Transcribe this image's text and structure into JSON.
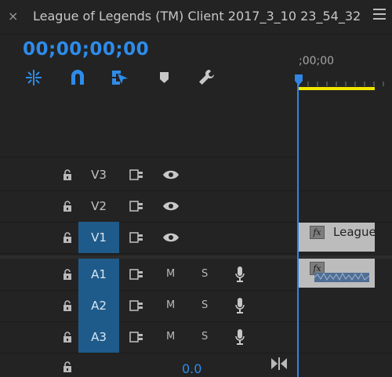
{
  "header": {
    "close_glyph": "×",
    "title": "League of Legends (TM) Client 2017_3_10 23_54_32",
    "menu_icon": "hamburger-menu-icon"
  },
  "timecode": "00;00;00;00",
  "tools": [
    "insert-snap-icon",
    "magnet-snap-icon",
    "linked-selection-icon",
    "add-marker-icon",
    "wrench-settings-icon"
  ],
  "ruler": {
    "start_label": ";00;00"
  },
  "tracks": {
    "video": [
      {
        "name": "V3",
        "selected": false
      },
      {
        "name": "V2",
        "selected": false
      },
      {
        "name": "V1",
        "selected": true
      }
    ],
    "audio": [
      {
        "name": "A1",
        "m": "M",
        "s": "S",
        "selected": true
      },
      {
        "name": "A2",
        "m": "M",
        "s": "S",
        "selected": true
      },
      {
        "name": "A3",
        "m": "M",
        "s": "S",
        "selected": true
      }
    ]
  },
  "clips": {
    "video_clip": {
      "fx": "fx",
      "label": "League"
    },
    "audio_clip": {
      "fx": "fx"
    }
  },
  "master": {
    "volume": "0.0"
  },
  "colors": {
    "accent": "#2d8ceb",
    "selected_track": "#1f5b8a",
    "work_area": "#f2e600",
    "playhead": "#2f86e3"
  }
}
